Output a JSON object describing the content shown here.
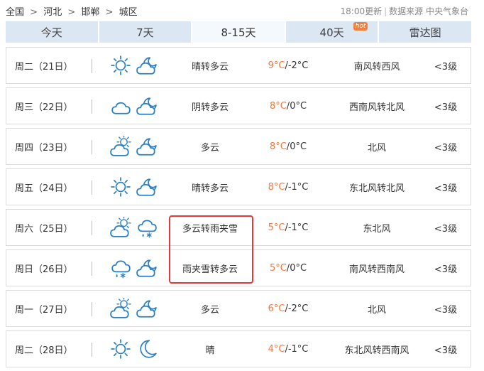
{
  "breadcrumb": {
    "items": [
      "全国",
      "河北",
      "邯郸",
      "城区"
    ],
    "separator": ">"
  },
  "source": {
    "update_time": "18:00更新",
    "source_label": "数据来源 中央气象台"
  },
  "tabs": [
    {
      "label": "今天",
      "active": false
    },
    {
      "label": "7天",
      "active": false
    },
    {
      "label": "8-15天",
      "active": true
    },
    {
      "label": "40天",
      "active": false,
      "badge": "hot"
    },
    {
      "label": "雷达图",
      "active": false
    }
  ],
  "forecast": [
    {
      "date": "周二（21日）",
      "icon_day": "sun-icon",
      "icon_night": "cloud-moon-icon",
      "desc": "晴转多云",
      "high": "9°C",
      "low": "-2°C",
      "wind": "南风转西风",
      "level": "<3级"
    },
    {
      "date": "周三（22日）",
      "icon_day": "cloud-icon",
      "icon_night": "cloud-moon-icon",
      "desc": "阴转多云",
      "high": "8°C",
      "low": "0°C",
      "wind": "西南风转北风",
      "level": "<3级"
    },
    {
      "date": "周四（23日）",
      "icon_day": "sun-cloud-icon",
      "icon_night": "cloud-moon-icon",
      "desc": "多云",
      "high": "8°C",
      "low": "0°C",
      "wind": "北风",
      "level": "<3级"
    },
    {
      "date": "周五（24日）",
      "icon_day": "sun-icon",
      "icon_night": "cloud-moon-icon",
      "desc": "晴转多云",
      "high": "8°C",
      "low": "-1°C",
      "wind": "东北风转北风",
      "level": "<3级"
    },
    {
      "date": "周六（25日）",
      "icon_day": "sun-cloud-icon",
      "icon_night": "sleet-icon",
      "desc": "多云转雨夹雪",
      "high": "5°C",
      "low": "-1°C",
      "wind": "东北风",
      "level": "<3级"
    },
    {
      "date": "周日（26日）",
      "icon_day": "sleet-icon",
      "icon_night": "cloud-moon-icon",
      "desc": "雨夹雪转多云",
      "high": "5°C",
      "low": "0°C",
      "wind": "南风转西南风",
      "level": "<3级"
    },
    {
      "date": "周一（27日）",
      "icon_day": "sun-cloud-icon",
      "icon_night": "cloud-moon-icon",
      "desc": "多云",
      "high": "6°C",
      "low": "-2°C",
      "wind": "北风",
      "level": "<3级"
    },
    {
      "date": "周二（28日）",
      "icon_day": "sun-icon",
      "icon_night": "moon-icon",
      "desc": "晴",
      "high": "4°C",
      "low": "-1°C",
      "wind": "东北风转西南风",
      "level": "<3级"
    }
  ],
  "colors": {
    "icon_blue": "#2a7fc4",
    "temp_high": "#f0783c",
    "tab_bg": "#dbe8f4",
    "highlight_border": "#e23a3a"
  }
}
